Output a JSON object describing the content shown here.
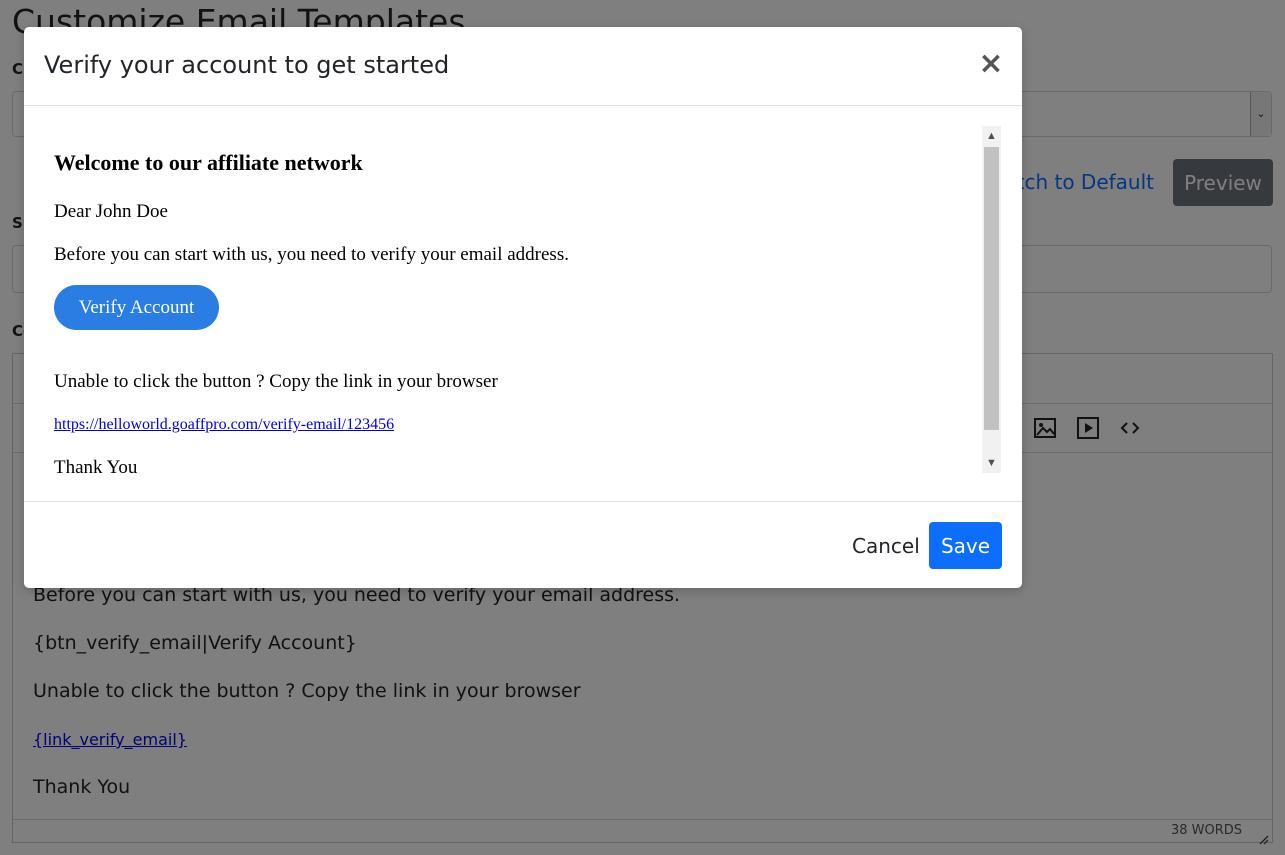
{
  "page": {
    "title": "Customize Email Templates",
    "labels": [
      "Ch",
      "Su",
      "Co"
    ],
    "switch_link": "witch to Default",
    "preview_button": "Preview"
  },
  "editor": {
    "lines": [
      "Before you can start with us, you need to verify your email address.",
      "{btn_verify_email|Verify Account}",
      "Unable to click the button ? Copy the link in your browser",
      "{link_verify_email}",
      "Thank You"
    ],
    "word_count": "38 WORDS",
    "toolbar_icons": [
      "image-icon",
      "media-icon",
      "code-icon"
    ]
  },
  "modal": {
    "title": "Verify your account to get started",
    "close_symbol": "×",
    "preview": {
      "heading": "Welcome to our affiliate network",
      "greeting": "Dear John Doe",
      "body": "Before you can start with us, you need to verify your email address.",
      "button": "Verify Account",
      "unable_text": "Unable to click the button ? Copy the link in your browser",
      "link": "https://helloworld.goaffpro.com/verify-email/123456",
      "thanks": "Thank You"
    },
    "cancel_button": "Cancel",
    "save_button": "Save"
  },
  "colors": {
    "primary": "#0d6efd",
    "secondary": "#6c757d",
    "verify_button": "#2a7ee3",
    "link": "#0000ee"
  }
}
